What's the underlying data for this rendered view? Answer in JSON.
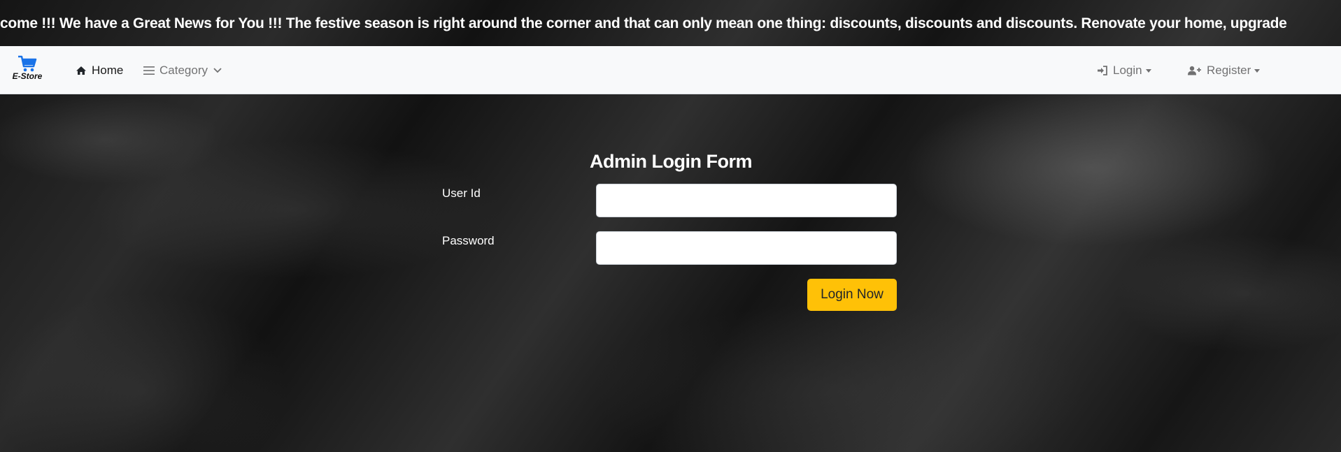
{
  "marquee": {
    "text": "Welcome !!! We have a Great News for You !!! The festive season is right around the corner and that can only mean one thing: discounts, discounts and discounts. Renovate your home, upgrade"
  },
  "navbar": {
    "brand_label": "E-Store",
    "brand_icon": "cart-icon",
    "home_label": "Home",
    "category_label": "Category",
    "login_label": "Login",
    "register_label": "Register"
  },
  "form": {
    "title": "Admin Login Form",
    "user_id_label": "User Id",
    "user_id_value": "",
    "password_label": "Password",
    "password_value": "",
    "submit_label": "Login Now"
  },
  "colors": {
    "accent_button": "#ffc107",
    "brand_icon": "#1a73e8",
    "navbar_bg": "#f8f9fa"
  }
}
